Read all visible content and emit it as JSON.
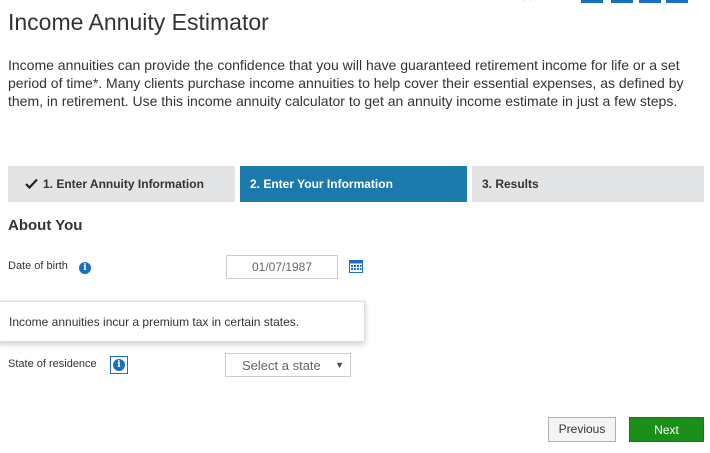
{
  "title": "Income Annuity Estimator",
  "intro": "Income annuities can provide the confidence that you will have guaranteed retirement income for life or a set period of time*. Many clients purchase income annuities to help cover their essential expenses, as defined by them, in retirement. Use this income annuity calculator to get an annuity income estimate in just a few steps.",
  "steps": [
    {
      "label": "1. Enter Annuity Information",
      "state": "completed",
      "icon": "check-icon"
    },
    {
      "label": "2. Enter Your Information",
      "state": "active"
    },
    {
      "label": "3. Results",
      "state": "upcoming"
    }
  ],
  "section": {
    "title": "About You"
  },
  "dob": {
    "label": "Date of birth",
    "value": "01/07/1987",
    "info_icon": "info-icon",
    "picker_icon": "calendar-icon"
  },
  "tooltip": {
    "text": "Income annuities incur a premium tax in certain states."
  },
  "state": {
    "label": "State of residence",
    "placeholder": "Select a state",
    "info_icon": "info-icon"
  },
  "buttons": {
    "previous": "Previous",
    "next": "Next"
  },
  "colors": {
    "active_step": "#1a7aab",
    "inactive_step": "#e2e4e6",
    "next_button": "#1a8f1a",
    "info_icon": "#1a6fc4"
  }
}
